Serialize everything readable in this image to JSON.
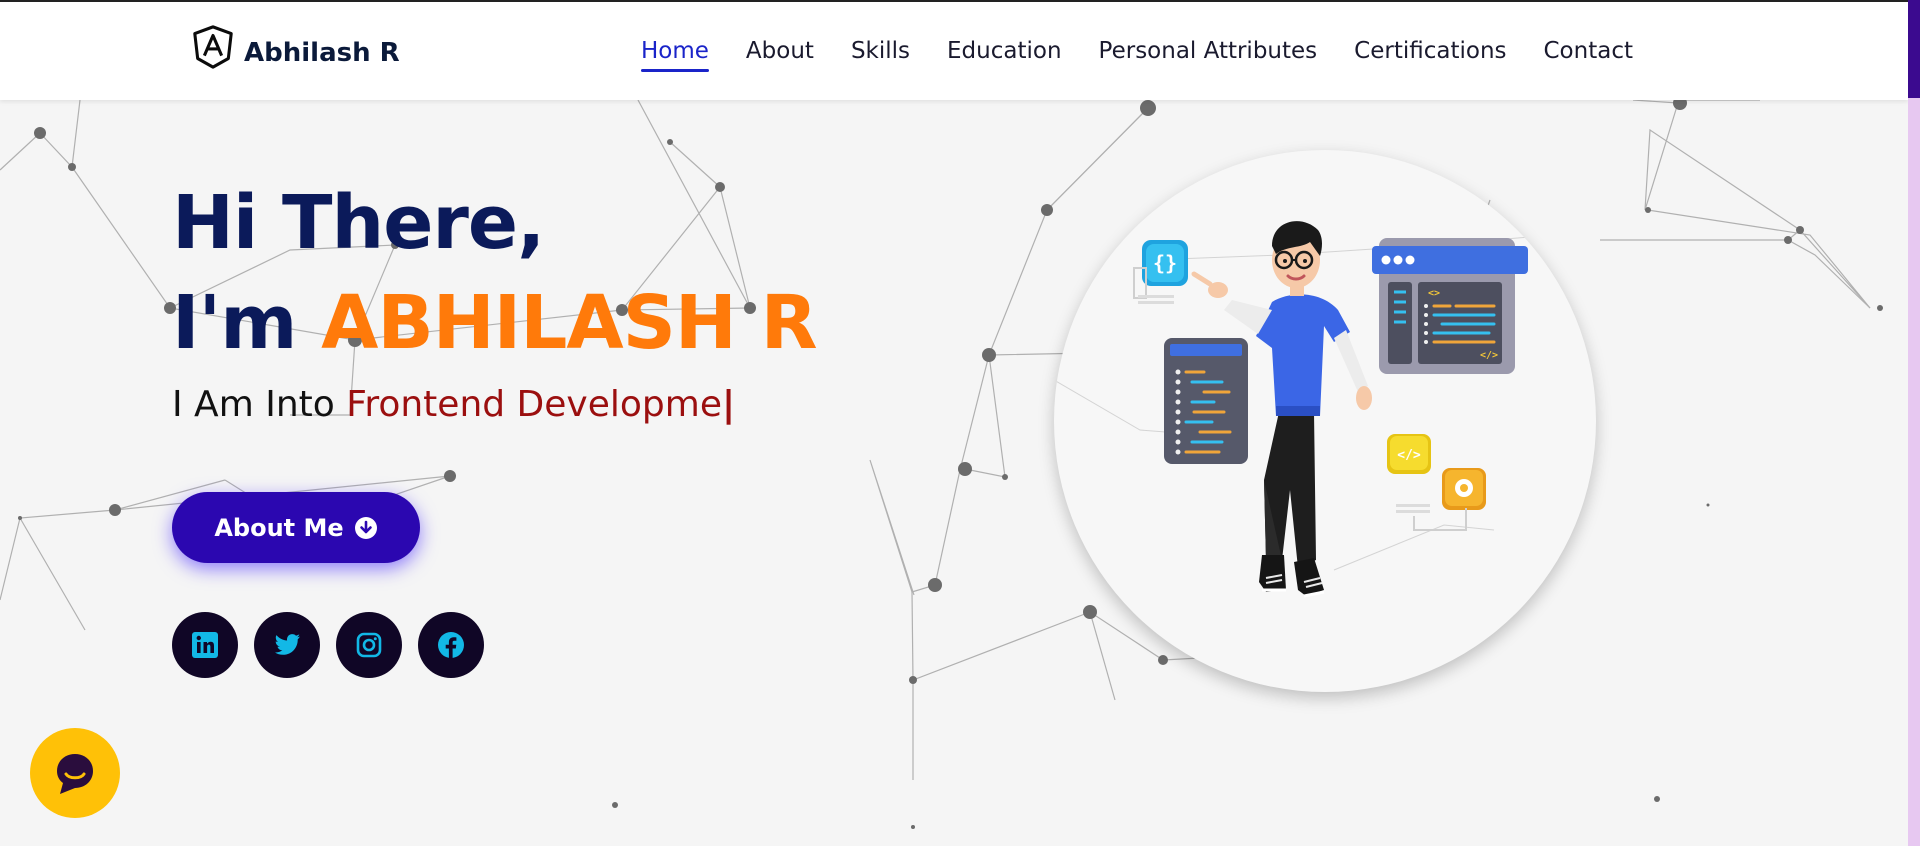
{
  "brand": {
    "name": "Abhilash R",
    "logo_icon": "angular-logo-icon"
  },
  "nav": {
    "items": [
      {
        "label": "Home",
        "active": true
      },
      {
        "label": "About",
        "active": false
      },
      {
        "label": "Skills",
        "active": false
      },
      {
        "label": "Education",
        "active": false
      },
      {
        "label": "Personal Attributes",
        "active": false
      },
      {
        "label": "Certifications",
        "active": false
      },
      {
        "label": "Contact",
        "active": false
      }
    ]
  },
  "hero": {
    "greeting": "Hi There,",
    "intro_prefix": "I'm",
    "name": "ABHILASH R",
    "into_prefix": "I Am Into",
    "typed_text": "Frontend Developme",
    "cursor": "|"
  },
  "cta": {
    "about_label": "About Me",
    "icon": "arrow-down-circle-icon"
  },
  "socials": [
    {
      "name": "linkedin-icon"
    },
    {
      "name": "twitter-icon"
    },
    {
      "name": "instagram-icon"
    },
    {
      "name": "facebook-icon"
    }
  ],
  "chat": {
    "icon": "chat-bubble-icon"
  },
  "colors": {
    "accent": "#1a24c9",
    "heading": "#0b1a5a",
    "name": "#ff7a0a",
    "typed": "#9b0f0f",
    "button": "#2b07b0",
    "social_bg": "#100626",
    "social_icon": "#12b8e6",
    "chat_bg": "#ffc107"
  }
}
